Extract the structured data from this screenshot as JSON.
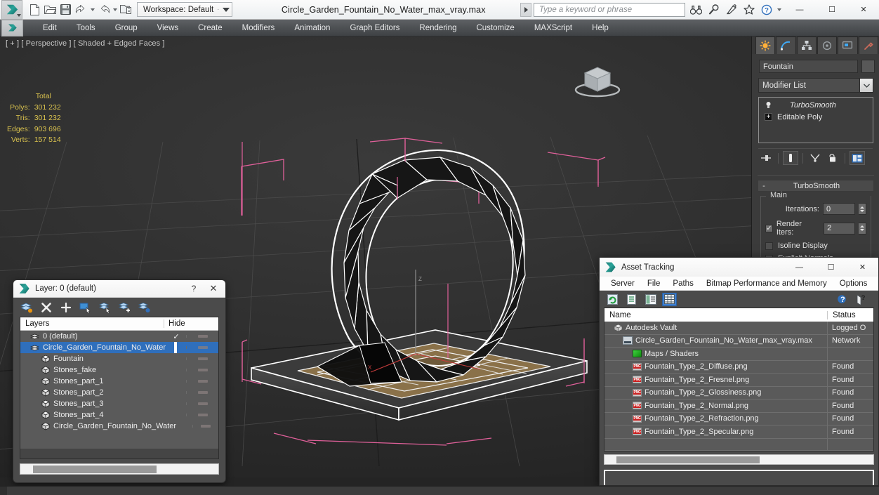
{
  "titlebar": {
    "document_title": "Circle_Garden_Fountain_No_Water_max_vray.max",
    "workspace_label": "Workspace: Default",
    "workspace_sep": "·",
    "search_placeholder": "Type a keyword or phrase",
    "quick_access": [
      {
        "name": "new-file-icon",
        "label": "New"
      },
      {
        "name": "open-file-icon",
        "label": "Open"
      },
      {
        "name": "save-file-icon",
        "label": "Save"
      },
      {
        "name": "undo-icon",
        "label": "Undo"
      },
      {
        "name": "redo-icon",
        "label": "Redo"
      },
      {
        "name": "project-folder-icon",
        "label": "Set Project Folder"
      }
    ],
    "right_icons": [
      {
        "name": "binoculars-icon",
        "label": "Search"
      },
      {
        "name": "magnifier-icon",
        "label": "Zoom"
      },
      {
        "name": "satellite-icon",
        "label": "Autodesk A360"
      },
      {
        "name": "star-icon",
        "label": "Favorites"
      },
      {
        "name": "help-icon",
        "label": "Help"
      }
    ],
    "window_buttons": {
      "minimize": "—",
      "maximize": "☐",
      "close": "✕"
    }
  },
  "menubar": {
    "items": [
      "Edit",
      "Tools",
      "Group",
      "Views",
      "Create",
      "Modifiers",
      "Animation",
      "Graph Editors",
      "Rendering",
      "Customize",
      "MAXScript",
      "Help"
    ]
  },
  "viewport": {
    "label": "[ + ] [ Perspective ] [ Shaded + Edged Faces ]",
    "stats": {
      "header": "Total",
      "rows": [
        {
          "label": "Polys:",
          "value": "301 232"
        },
        {
          "label": "Tris:",
          "value": "301 232"
        },
        {
          "label": "Edges:",
          "value": "903 696"
        },
        {
          "label": "Verts:",
          "value": "157 514"
        }
      ]
    }
  },
  "command_panel": {
    "tabs": [
      {
        "name": "create-tab",
        "label": "Create"
      },
      {
        "name": "modify-tab",
        "label": "Modify"
      },
      {
        "name": "hierarchy-tab",
        "label": "Hierarchy"
      },
      {
        "name": "motion-tab",
        "label": "Motion"
      },
      {
        "name": "display-tab",
        "label": "Display"
      },
      {
        "name": "utilities-tab",
        "label": "Utilities"
      }
    ],
    "object_name": "Fountain",
    "modifier_list_label": "Modifier List",
    "stack": [
      {
        "label": "TurboSmooth",
        "italic": true
      },
      {
        "label": "Editable Poly",
        "italic": false
      }
    ],
    "stack_buttons": [
      {
        "name": "pin-stack-icon"
      },
      {
        "name": "show-end-result-icon"
      },
      {
        "name": "make-unique-icon"
      },
      {
        "name": "remove-modifier-icon"
      },
      {
        "name": "configure-modifier-sets-icon"
      }
    ],
    "rollout": {
      "title": "TurboSmooth",
      "collapse_glyph": "-",
      "group_title": "Main",
      "iterations_label": "Iterations:",
      "iterations_value": "0",
      "render_iters_label": "Render Iters:",
      "render_iters_value": "2",
      "render_iters_checked": true,
      "isoline_display_label": "Isoline Display",
      "isoline_display_checked": false,
      "explicit_normals_label": "Explicit Normals",
      "explicit_normals_checked": false
    }
  },
  "layer_dialog": {
    "title": "Layer: 0 (default)",
    "help_glyph": "?",
    "close_glyph": "✕",
    "toolbar": [
      {
        "name": "new-layer-icon"
      },
      {
        "name": "delete-layer-icon"
      },
      {
        "name": "add-layer-icon"
      },
      {
        "name": "select-objects-in-layer-icon"
      },
      {
        "name": "select-highlighted-layers-icon"
      },
      {
        "name": "add-selection-to-layer-icon"
      },
      {
        "name": "set-current-layer-icon"
      }
    ],
    "columns": {
      "name": "Layers",
      "hide": "Hide"
    },
    "rows": [
      {
        "label": "0 (default)",
        "indent": 0,
        "type": "layer",
        "selected": false,
        "current": true,
        "checkbox": false
      },
      {
        "label": "Circle_Garden_Fountain_No_Water",
        "indent": 0,
        "type": "layer",
        "selected": true,
        "current": false,
        "checkbox": true
      },
      {
        "label": "Fountain",
        "indent": 1,
        "type": "object",
        "selected": false,
        "current": false,
        "checkbox": false
      },
      {
        "label": "Stones_fake",
        "indent": 1,
        "type": "object",
        "selected": false,
        "current": false,
        "checkbox": false
      },
      {
        "label": "Stones_part_1",
        "indent": 1,
        "type": "object",
        "selected": false,
        "current": false,
        "checkbox": false
      },
      {
        "label": "Stones_part_2",
        "indent": 1,
        "type": "object",
        "selected": false,
        "current": false,
        "checkbox": false
      },
      {
        "label": "Stones_part_3",
        "indent": 1,
        "type": "object",
        "selected": false,
        "current": false,
        "checkbox": false
      },
      {
        "label": "Stones_part_4",
        "indent": 1,
        "type": "object",
        "selected": false,
        "current": false,
        "checkbox": false
      },
      {
        "label": "Circle_Garden_Fountain_No_Water",
        "indent": 1,
        "type": "object",
        "selected": false,
        "current": false,
        "checkbox": false
      }
    ]
  },
  "asset_tracking": {
    "title": "Asset Tracking",
    "window_buttons": {
      "minimize": "—",
      "maximize": "☐",
      "close": "✕"
    },
    "menu": [
      "Server",
      "File",
      "Paths",
      "Bitmap Performance and Memory",
      "Options"
    ],
    "toolbar": [
      {
        "name": "refresh-icon",
        "active": false
      },
      {
        "name": "list-view-icon",
        "active": false
      },
      {
        "name": "detail-view-icon",
        "active": false
      },
      {
        "name": "grid-view-icon",
        "active": true
      }
    ],
    "help_icons": [
      {
        "name": "help-icon"
      },
      {
        "name": "context-help-icon"
      }
    ],
    "columns": {
      "name": "Name",
      "status": "Status"
    },
    "rows": [
      {
        "label": "Autodesk Vault",
        "status": "Logged O",
        "indent": 1,
        "icon": "vault"
      },
      {
        "label": "Circle_Garden_Fountain_No_Water_max_vray.max",
        "status": "Network",
        "indent": 2,
        "icon": "max"
      },
      {
        "label": "Maps / Shaders",
        "status": "",
        "indent": 3,
        "icon": "maps"
      },
      {
        "label": "Fountain_Type_2_Diffuse.png",
        "status": "Found",
        "indent": 3,
        "icon": "png"
      },
      {
        "label": "Fountain_Type_2_Fresnel.png",
        "status": "Found",
        "indent": 3,
        "icon": "png"
      },
      {
        "label": "Fountain_Type_2_Glossiness.png",
        "status": "Found",
        "indent": 3,
        "icon": "png"
      },
      {
        "label": "Fountain_Type_2_Normal.png",
        "status": "Found",
        "indent": 3,
        "icon": "png"
      },
      {
        "label": "Fountain_Type_2_Refraction.png",
        "status": "Found",
        "indent": 3,
        "icon": "png"
      },
      {
        "label": "Fountain_Type_2_Specular.png",
        "status": "Found",
        "indent": 3,
        "icon": "png"
      }
    ]
  },
  "colors": {
    "accent_blue": "#2f6fbc",
    "stats_yellow": "#d8c14e",
    "viewport_bg": "#303030",
    "panel_bg": "#3b3b3b",
    "gizmo_pink": "#e0609a",
    "teal_logo": "#2aa49a"
  }
}
